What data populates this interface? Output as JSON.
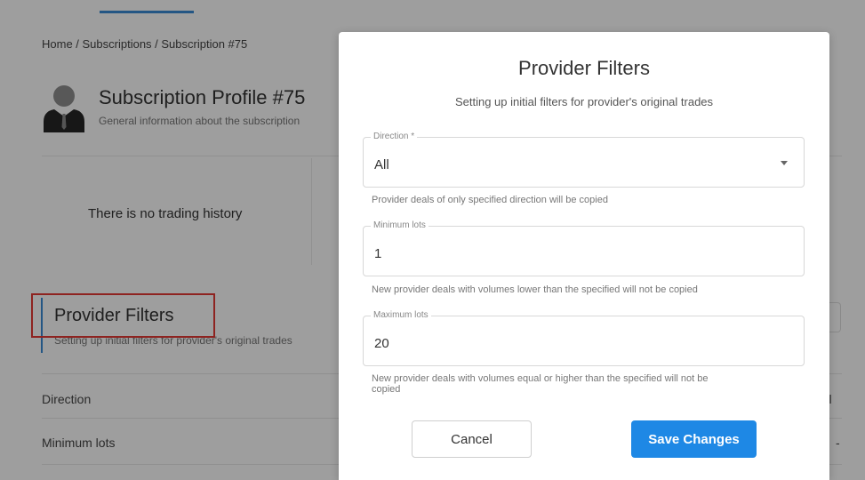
{
  "breadcrumb": "Home / Subscriptions / Subscription #75",
  "profile": {
    "title": "Subscription Profile #75",
    "subtitle": "General information about the subscription"
  },
  "no_history": "There is no trading history",
  "background_filters": {
    "title": "Provider Filters",
    "subtitle": "Setting up initial filters for provider's original trades",
    "rows": [
      {
        "label": "Direction",
        "value": "All"
      },
      {
        "label": "Minimum lots",
        "value": "-"
      }
    ]
  },
  "modal": {
    "title": "Provider Filters",
    "subtitle": "Setting up initial filters for provider's original trades",
    "direction": {
      "legend": "Direction *",
      "value": "All",
      "help": "Provider deals of only specified direction will be copied"
    },
    "min_lots": {
      "legend": "Minimum lots",
      "value": "1",
      "help": "New provider deals with volumes lower than the specified will not be copied"
    },
    "max_lots": {
      "legend": "Maximum lots",
      "value": "20",
      "help_line1": "New provider deals with volumes equal or higher than the specified will not be",
      "help_line2": "copied"
    },
    "cancel_label": "Cancel",
    "save_label": "Save Changes"
  },
  "colors": {
    "accent": "#1e88e5",
    "highlight": "#e53935"
  }
}
